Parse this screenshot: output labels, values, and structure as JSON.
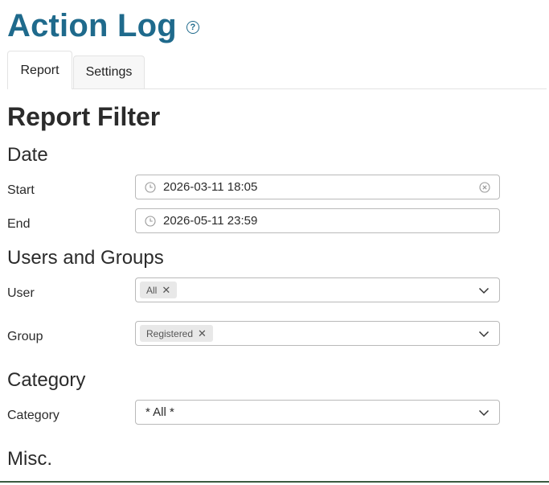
{
  "header": {
    "title": "Action Log",
    "help_glyph": "?"
  },
  "tabs": [
    {
      "label": "Report",
      "active": true
    },
    {
      "label": "Settings",
      "active": false
    }
  ],
  "filter": {
    "heading": "Report Filter",
    "date": {
      "heading": "Date",
      "start_label": "Start",
      "start_value": "2026-03-11 18:05",
      "end_label": "End",
      "end_value": "2026-05-11 23:59"
    },
    "users_groups": {
      "heading": "Users and Groups",
      "user_label": "User",
      "user_chip": "All",
      "group_label": "Group",
      "group_chip": "Registered"
    },
    "category": {
      "heading": "Category",
      "label": "Category",
      "value": "* All *"
    },
    "misc": {
      "heading": "Misc."
    }
  },
  "colors": {
    "title": "#1f6a8c",
    "border": "#b9b9b9",
    "chip_bg": "#e8e8e8"
  },
  "icons": {
    "help": "help-icon",
    "clock": "clock-icon",
    "clear": "clear-icon",
    "chevron": "chevron-down-icon",
    "remove": "remove-chip-icon"
  }
}
